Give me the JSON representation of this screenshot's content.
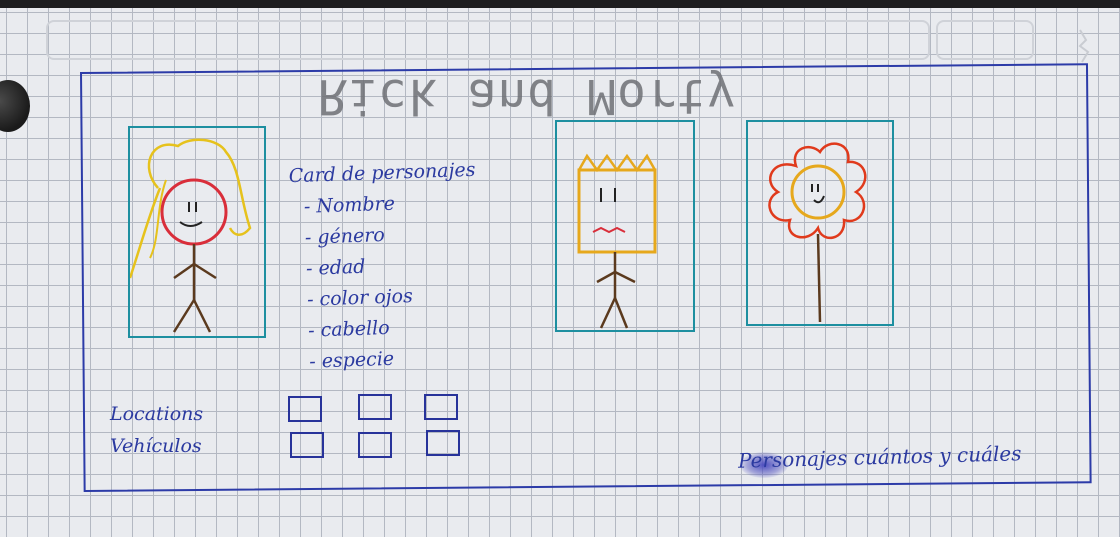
{
  "sketch": {
    "title": "Rick and Morty",
    "notes": {
      "heading": "Card de personajes",
      "fields": [
        "- Nombre",
        "- género",
        "- edad",
        "- color ojos",
        "- cabello",
        "- especie"
      ]
    },
    "side_labels": [
      "Locations",
      "Vehículos"
    ],
    "footer_note": "Personajes cuántos y cuáles",
    "colors": {
      "ink": "#2b3aa0",
      "card_border": "#1d8fa0",
      "pencil": "#6e7075"
    }
  }
}
